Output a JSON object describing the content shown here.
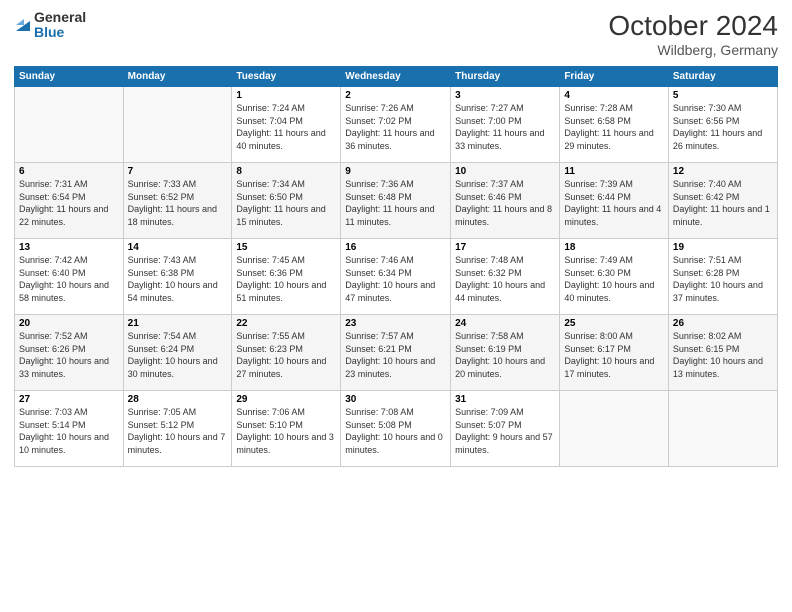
{
  "logo": {
    "general": "General",
    "blue": "Blue"
  },
  "title": {
    "month_year": "October 2024",
    "location": "Wildberg, Germany"
  },
  "calendar": {
    "headers": [
      "Sunday",
      "Monday",
      "Tuesday",
      "Wednesday",
      "Thursday",
      "Friday",
      "Saturday"
    ],
    "rows": [
      [
        {
          "day": "",
          "sunrise": "",
          "sunset": "",
          "daylight": "",
          "empty": true
        },
        {
          "day": "",
          "sunrise": "",
          "sunset": "",
          "daylight": "",
          "empty": true
        },
        {
          "day": "1",
          "sunrise": "Sunrise: 7:24 AM",
          "sunset": "Sunset: 7:04 PM",
          "daylight": "Daylight: 11 hours and 40 minutes."
        },
        {
          "day": "2",
          "sunrise": "Sunrise: 7:26 AM",
          "sunset": "Sunset: 7:02 PM",
          "daylight": "Daylight: 11 hours and 36 minutes."
        },
        {
          "day": "3",
          "sunrise": "Sunrise: 7:27 AM",
          "sunset": "Sunset: 7:00 PM",
          "daylight": "Daylight: 11 hours and 33 minutes."
        },
        {
          "day": "4",
          "sunrise": "Sunrise: 7:28 AM",
          "sunset": "Sunset: 6:58 PM",
          "daylight": "Daylight: 11 hours and 29 minutes."
        },
        {
          "day": "5",
          "sunrise": "Sunrise: 7:30 AM",
          "sunset": "Sunset: 6:56 PM",
          "daylight": "Daylight: 11 hours and 26 minutes."
        }
      ],
      [
        {
          "day": "6",
          "sunrise": "Sunrise: 7:31 AM",
          "sunset": "Sunset: 6:54 PM",
          "daylight": "Daylight: 11 hours and 22 minutes."
        },
        {
          "day": "7",
          "sunrise": "Sunrise: 7:33 AM",
          "sunset": "Sunset: 6:52 PM",
          "daylight": "Daylight: 11 hours and 18 minutes."
        },
        {
          "day": "8",
          "sunrise": "Sunrise: 7:34 AM",
          "sunset": "Sunset: 6:50 PM",
          "daylight": "Daylight: 11 hours and 15 minutes."
        },
        {
          "day": "9",
          "sunrise": "Sunrise: 7:36 AM",
          "sunset": "Sunset: 6:48 PM",
          "daylight": "Daylight: 11 hours and 11 minutes."
        },
        {
          "day": "10",
          "sunrise": "Sunrise: 7:37 AM",
          "sunset": "Sunset: 6:46 PM",
          "daylight": "Daylight: 11 hours and 8 minutes."
        },
        {
          "day": "11",
          "sunrise": "Sunrise: 7:39 AM",
          "sunset": "Sunset: 6:44 PM",
          "daylight": "Daylight: 11 hours and 4 minutes."
        },
        {
          "day": "12",
          "sunrise": "Sunrise: 7:40 AM",
          "sunset": "Sunset: 6:42 PM",
          "daylight": "Daylight: 11 hours and 1 minute."
        }
      ],
      [
        {
          "day": "13",
          "sunrise": "Sunrise: 7:42 AM",
          "sunset": "Sunset: 6:40 PM",
          "daylight": "Daylight: 10 hours and 58 minutes."
        },
        {
          "day": "14",
          "sunrise": "Sunrise: 7:43 AM",
          "sunset": "Sunset: 6:38 PM",
          "daylight": "Daylight: 10 hours and 54 minutes."
        },
        {
          "day": "15",
          "sunrise": "Sunrise: 7:45 AM",
          "sunset": "Sunset: 6:36 PM",
          "daylight": "Daylight: 10 hours and 51 minutes."
        },
        {
          "day": "16",
          "sunrise": "Sunrise: 7:46 AM",
          "sunset": "Sunset: 6:34 PM",
          "daylight": "Daylight: 10 hours and 47 minutes."
        },
        {
          "day": "17",
          "sunrise": "Sunrise: 7:48 AM",
          "sunset": "Sunset: 6:32 PM",
          "daylight": "Daylight: 10 hours and 44 minutes."
        },
        {
          "day": "18",
          "sunrise": "Sunrise: 7:49 AM",
          "sunset": "Sunset: 6:30 PM",
          "daylight": "Daylight: 10 hours and 40 minutes."
        },
        {
          "day": "19",
          "sunrise": "Sunrise: 7:51 AM",
          "sunset": "Sunset: 6:28 PM",
          "daylight": "Daylight: 10 hours and 37 minutes."
        }
      ],
      [
        {
          "day": "20",
          "sunrise": "Sunrise: 7:52 AM",
          "sunset": "Sunset: 6:26 PM",
          "daylight": "Daylight: 10 hours and 33 minutes."
        },
        {
          "day": "21",
          "sunrise": "Sunrise: 7:54 AM",
          "sunset": "Sunset: 6:24 PM",
          "daylight": "Daylight: 10 hours and 30 minutes."
        },
        {
          "day": "22",
          "sunrise": "Sunrise: 7:55 AM",
          "sunset": "Sunset: 6:23 PM",
          "daylight": "Daylight: 10 hours and 27 minutes."
        },
        {
          "day": "23",
          "sunrise": "Sunrise: 7:57 AM",
          "sunset": "Sunset: 6:21 PM",
          "daylight": "Daylight: 10 hours and 23 minutes."
        },
        {
          "day": "24",
          "sunrise": "Sunrise: 7:58 AM",
          "sunset": "Sunset: 6:19 PM",
          "daylight": "Daylight: 10 hours and 20 minutes."
        },
        {
          "day": "25",
          "sunrise": "Sunrise: 8:00 AM",
          "sunset": "Sunset: 6:17 PM",
          "daylight": "Daylight: 10 hours and 17 minutes."
        },
        {
          "day": "26",
          "sunrise": "Sunrise: 8:02 AM",
          "sunset": "Sunset: 6:15 PM",
          "daylight": "Daylight: 10 hours and 13 minutes."
        }
      ],
      [
        {
          "day": "27",
          "sunrise": "Sunrise: 7:03 AM",
          "sunset": "Sunset: 5:14 PM",
          "daylight": "Daylight: 10 hours and 10 minutes."
        },
        {
          "day": "28",
          "sunrise": "Sunrise: 7:05 AM",
          "sunset": "Sunset: 5:12 PM",
          "daylight": "Daylight: 10 hours and 7 minutes."
        },
        {
          "day": "29",
          "sunrise": "Sunrise: 7:06 AM",
          "sunset": "Sunset: 5:10 PM",
          "daylight": "Daylight: 10 hours and 3 minutes."
        },
        {
          "day": "30",
          "sunrise": "Sunrise: 7:08 AM",
          "sunset": "Sunset: 5:08 PM",
          "daylight": "Daylight: 10 hours and 0 minutes."
        },
        {
          "day": "31",
          "sunrise": "Sunrise: 7:09 AM",
          "sunset": "Sunset: 5:07 PM",
          "daylight": "Daylight: 9 hours and 57 minutes."
        },
        {
          "day": "",
          "sunrise": "",
          "sunset": "",
          "daylight": "",
          "empty": true
        },
        {
          "day": "",
          "sunrise": "",
          "sunset": "",
          "daylight": "",
          "empty": true
        }
      ]
    ]
  }
}
